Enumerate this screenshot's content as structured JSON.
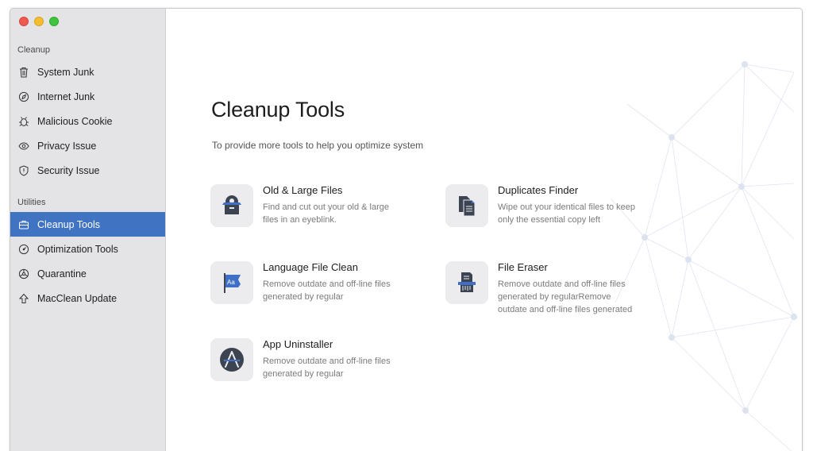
{
  "sidebar": {
    "sections": [
      {
        "label": "Cleanup",
        "items": [
          {
            "label": "System Junk",
            "icon": "trash-icon"
          },
          {
            "label": "Internet Junk",
            "icon": "globe-icon"
          },
          {
            "label": "Malicious Cookie",
            "icon": "bug-icon"
          },
          {
            "label": "Privacy Issue",
            "icon": "eye-icon"
          },
          {
            "label": "Security Issue",
            "icon": "shield-icon"
          }
        ]
      },
      {
        "label": "Utilities",
        "items": [
          {
            "label": "Cleanup Tools",
            "icon": "toolbox-icon",
            "active": true
          },
          {
            "label": "Optimization Tools",
            "icon": "gauge-icon"
          },
          {
            "label": "Quarantine",
            "icon": "biohazard-icon"
          },
          {
            "label": "MacClean Update",
            "icon": "arrow-up-icon"
          }
        ]
      }
    ]
  },
  "main": {
    "title": "Cleanup Tools",
    "subtitle": "To provide more tools to help you optimize system",
    "tools": [
      {
        "name": "Old & Large Files",
        "desc": "Find and cut out your old & large files in an eyeblink.",
        "icon": "box-icon"
      },
      {
        "name": "Duplicates Finder",
        "desc": "Wipe out your identical files to keep only the essential copy left",
        "icon": "documents-icon"
      },
      {
        "name": "Language File Clean",
        "desc": "Remove outdate and off-line files generated by regular",
        "icon": "flag-icon"
      },
      {
        "name": "File Eraser",
        "desc": "Remove outdate and off-line files generated by regularRemove outdate and off-line files generated",
        "icon": "shredder-icon"
      },
      {
        "name": "App Uninstaller",
        "desc": "Remove outdate and off-line files generated by regular",
        "icon": "app-store-icon"
      }
    ]
  },
  "colors": {
    "accent": "#4074c3",
    "sidebar_bg": "#e4e4e6",
    "icon_dark": "#3c4452",
    "icon_blue": "#3f6fc6"
  }
}
